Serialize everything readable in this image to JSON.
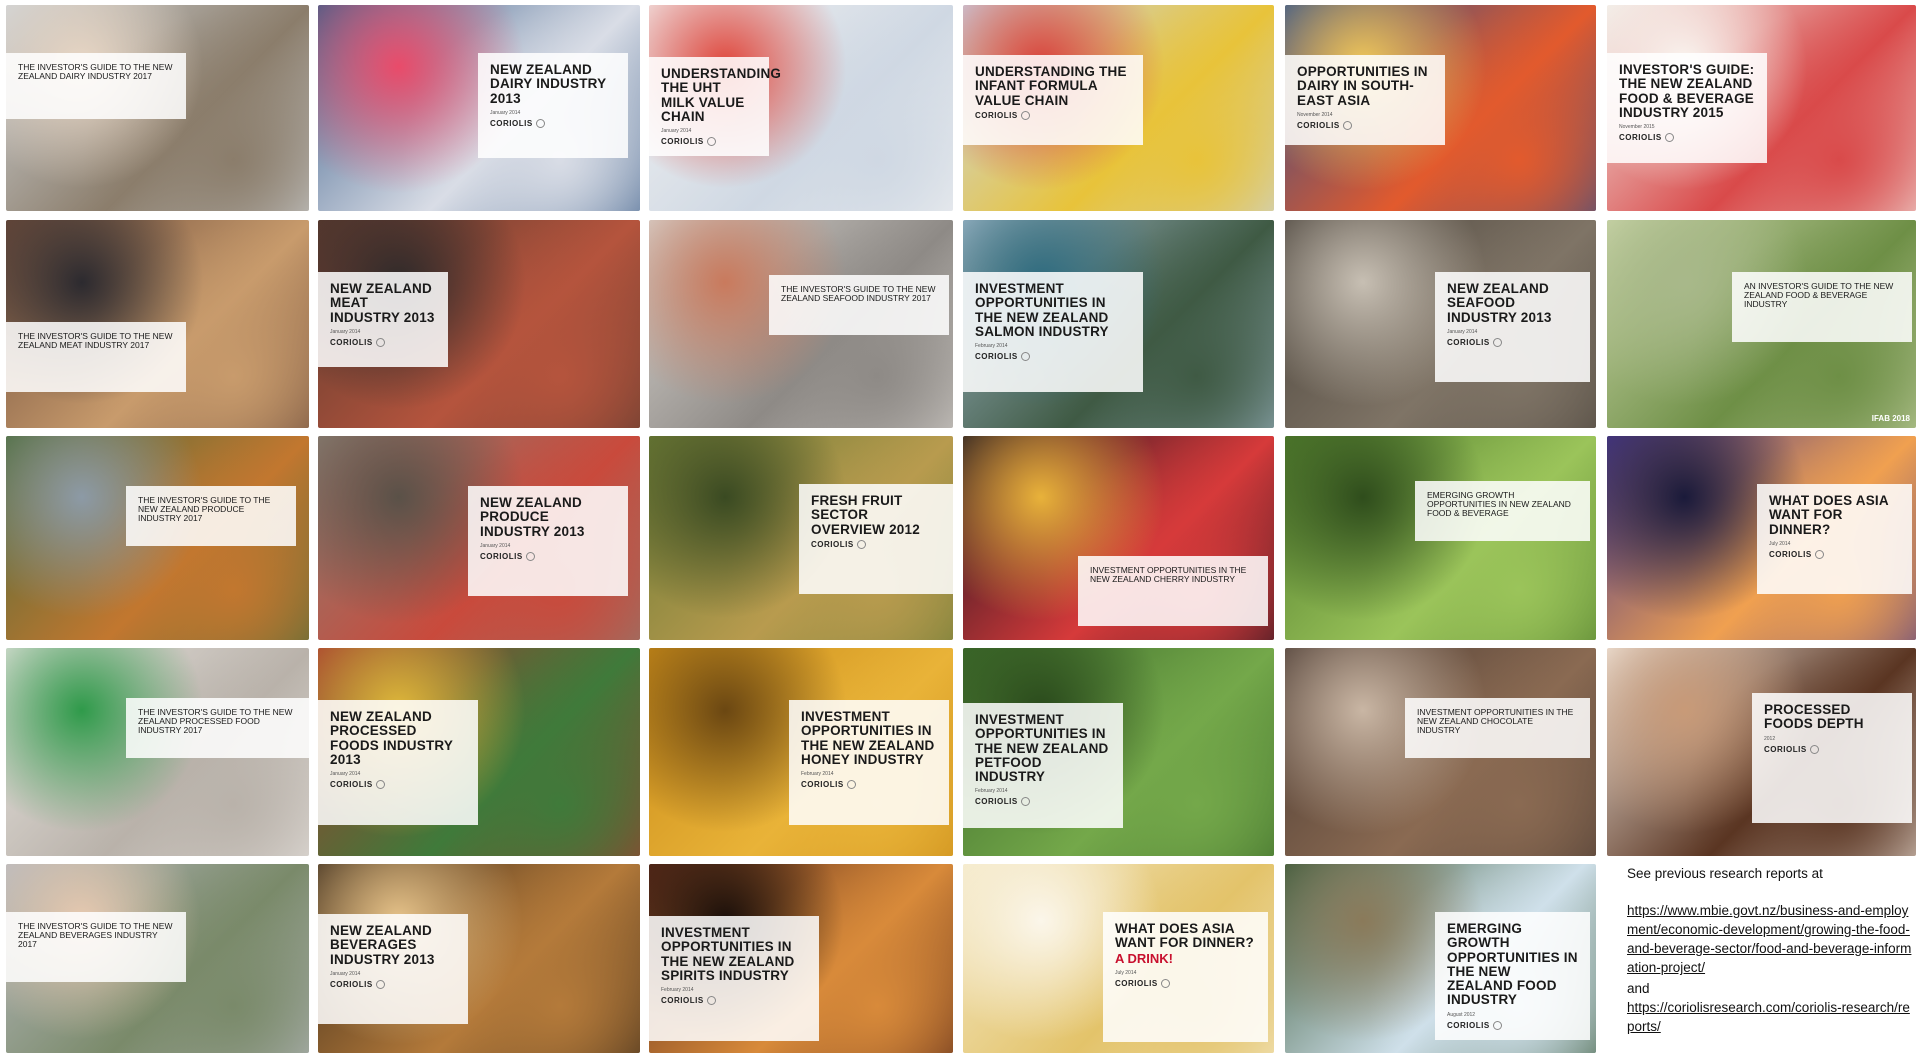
{
  "tiles": [
    {
      "title": "THE INVESTOR'S GUIDE TO THE NEW ZEALAND DAIRY INDUSTRY 2017",
      "small": true,
      "colors": [
        "#cfd3d6",
        "#8b7d6b",
        "#e9d7c5"
      ]
    },
    {
      "title": "NEW ZEALAND DAIRY INDUSTRY 2013",
      "date": "January 2014",
      "logo": "CORIOLIS",
      "colors": [
        "#3d5f8a",
        "#d9dde6",
        "#e94b6a"
      ]
    },
    {
      "title": "UNDERSTANDING THE UHT MILK VALUE CHAIN",
      "date": "January 2014",
      "logo": "CORIOLIS",
      "colors": [
        "#f2f2f2",
        "#cfd8e3",
        "#e0463b"
      ]
    },
    {
      "title": "UNDERSTANDING THE INFANT FORMULA VALUE CHAIN",
      "logo": "CORIOLIS",
      "colors": [
        "#c9d6e8",
        "#e8c33a",
        "#d9413b"
      ]
    },
    {
      "title": "OPPORTUNITIES IN DAIRY IN SOUTH-EAST ASIA",
      "date": "November 2014",
      "logo": "CORIOLIS",
      "colors": [
        "#2f4f8a",
        "#e25a2d",
        "#f0c95a"
      ]
    },
    {
      "title": "INVESTOR'S GUIDE: THE NEW ZEALAND FOOD & BEVERAGE INDUSTRY 2015",
      "date": "November 2015",
      "logo": "CORIOLIS",
      "colors": [
        "#f1ece6",
        "#d94a4a",
        "#faf7f2"
      ]
    },
    {
      "title": "THE INVESTOR'S GUIDE TO THE NEW ZEALAND MEAT INDUSTRY 2017",
      "small": true,
      "colors": [
        "#6b4a3a",
        "#c89b6c",
        "#2c2a2f"
      ]
    },
    {
      "title": "NEW ZEALAND MEAT INDUSTRY 2013",
      "date": "January 2014",
      "logo": "CORIOLIS",
      "colors": [
        "#5a3a2e",
        "#b5543d",
        "#2f2a2a"
      ]
    },
    {
      "title": "THE INVESTOR'S GUIDE TO THE NEW ZEALAND SEAFOOD INDUSTRY 2017",
      "small": true,
      "colors": [
        "#d8d4cf",
        "#8e8a86",
        "#c97a5d"
      ]
    },
    {
      "title": "INVESTMENT OPPORTUNITIES IN THE NEW ZEALAND SALMON INDUSTRY",
      "date": "February 2014",
      "logo": "CORIOLIS",
      "colors": [
        "#9fb7c7",
        "#3f5a44",
        "#2e6b7f"
      ]
    },
    {
      "title": "NEW ZEALAND SEAFOOD INDUSTRY 2013",
      "date": "January 2014",
      "logo": "CORIOLIS",
      "colors": [
        "#4a433b",
        "#7f7466",
        "#c7bfb3"
      ]
    },
    {
      "title": "AN INVESTOR'S GUIDE TO THE NEW ZEALAND FOOD & BEVERAGE INDUSTRY",
      "small": true,
      "stamp": "IFAB 2018",
      "colors": [
        "#c9d4a8",
        "#6e8f46",
        "#a8b88a"
      ]
    },
    {
      "title": "THE INVESTOR'S GUIDE TO THE NEW ZEALAND PRODUCE INDUSTRY 2017",
      "small": true,
      "colors": [
        "#4b6b3a",
        "#c2772f",
        "#8c9aa6"
      ]
    },
    {
      "title": "NEW ZEALAND PRODUCE INDUSTRY 2013",
      "date": "January 2014",
      "logo": "CORIOLIS",
      "colors": [
        "#8a7e72",
        "#c94a3c",
        "#5a5148"
      ]
    },
    {
      "title": "FRESH FRUIT SECTOR OVERVIEW 2012",
      "logo": "CORIOLIS",
      "colors": [
        "#6b7a35",
        "#b89b4e",
        "#3a4a22"
      ]
    },
    {
      "title": "INVESTMENT OPPORTUNITIES IN THE NEW ZEALAND CHERRY INDUSTRY",
      "small": true,
      "colors": [
        "#1c1420",
        "#d63a3a",
        "#e8b23a"
      ]
    },
    {
      "title": "EMERGING GROWTH OPPORTUNITIES IN NEW ZEALAND FOOD & BEVERAGE",
      "small": true,
      "colors": [
        "#4f7b2c",
        "#9bc45a",
        "#2f4d1c"
      ]
    },
    {
      "title": "WHAT DOES ASIA WANT FOR DINNER?",
      "date": "July 2014",
      "logo": "CORIOLIS",
      "colors": [
        "#4a3a8a",
        "#f0a050",
        "#1a1a3a"
      ]
    },
    {
      "title": "THE INVESTOR'S GUIDE TO THE NEW ZEALAND PROCESSED FOOD INDUSTRY 2017",
      "small": true,
      "colors": [
        "#e8e4e0",
        "#b9b2aa",
        "#2f9a4a"
      ]
    },
    {
      "title": "NEW ZEALAND PROCESSED FOODS INDUSTRY 2013",
      "date": "January 2014",
      "logo": "CORIOLIS",
      "colors": [
        "#a33a2e",
        "#3f7a3a",
        "#e0b83a"
      ]
    },
    {
      "title": "INVESTMENT OPPORTUNITIES IN THE NEW ZEALAND HONEY INDUSTRY",
      "date": "February 2014",
      "logo": "CORIOLIS",
      "colors": [
        "#c88a18",
        "#e9b338",
        "#6b4712"
      ]
    },
    {
      "title": "INVESTMENT OPPORTUNITIES IN THE NEW ZEALAND PETFOOD INDUSTRY",
      "date": "February 2014",
      "logo": "CORIOLIS",
      "colors": [
        "#3c6a2a",
        "#74a84a",
        "#2a4a1c"
      ]
    },
    {
      "title": "INVESTMENT OPPORTUNITIES IN THE NEW ZEALAND CHOCOLATE INDUSTRY",
      "small": true,
      "colors": [
        "#4a3a32",
        "#8a6a52",
        "#c9b6a4"
      ]
    },
    {
      "title": "PROCESSED FOODS DEPTH",
      "date": "2012",
      "logo": "CORIOLIS",
      "colors": [
        "#f0e6dc",
        "#5a3522",
        "#c89a78"
      ]
    },
    {
      "title": "THE INVESTOR'S GUIDE TO THE NEW ZEALAND BEVERAGES INDUSTRY 2017",
      "small": true,
      "colors": [
        "#b7b9bf",
        "#7a8a6a",
        "#e7c9b0"
      ]
    },
    {
      "title": "NEW ZEALAND BEVERAGES INDUSTRY 2013",
      "date": "January 2014",
      "logo": "CORIOLIS",
      "colors": [
        "#3a2a1a",
        "#b47a3a",
        "#e6c38a"
      ]
    },
    {
      "title": "INVESTMENT OPPORTUNITIES IN THE NEW ZEALAND SPIRITS INDUSTRY",
      "date": "February 2014",
      "logo": "CORIOLIS",
      "colors": [
        "#5a2a1a",
        "#d88a3a",
        "#1a0f0a"
      ]
    },
    {
      "title": "WHAT DOES ASIA WANT FOR DINNER?",
      "accent": "A DRINK!",
      "date": "July 2014",
      "logo": "CORIOLIS",
      "colors": [
        "#f4e9c8",
        "#e3c36a",
        "#fbf6ea"
      ]
    },
    {
      "title": "EMERGING GROWTH OPPORTUNITIES IN THE NEW ZEALAND FOOD INDUSTRY",
      "date": "August 2012",
      "logo": "CORIOLIS",
      "colors": [
        "#3b5a3a",
        "#cfe0ea",
        "#8a7a5a"
      ]
    }
  ],
  "note": {
    "intro": "See previous research reports at",
    "link1": "https://www.mbie.govt.nz/business-and-employment/economic-development/growing-the-food-and-beverage-sector/food-and-beverage-information-project/",
    "and": "and",
    "link2": "https://coriolisresearch.com/coriolis-research/reports/"
  }
}
